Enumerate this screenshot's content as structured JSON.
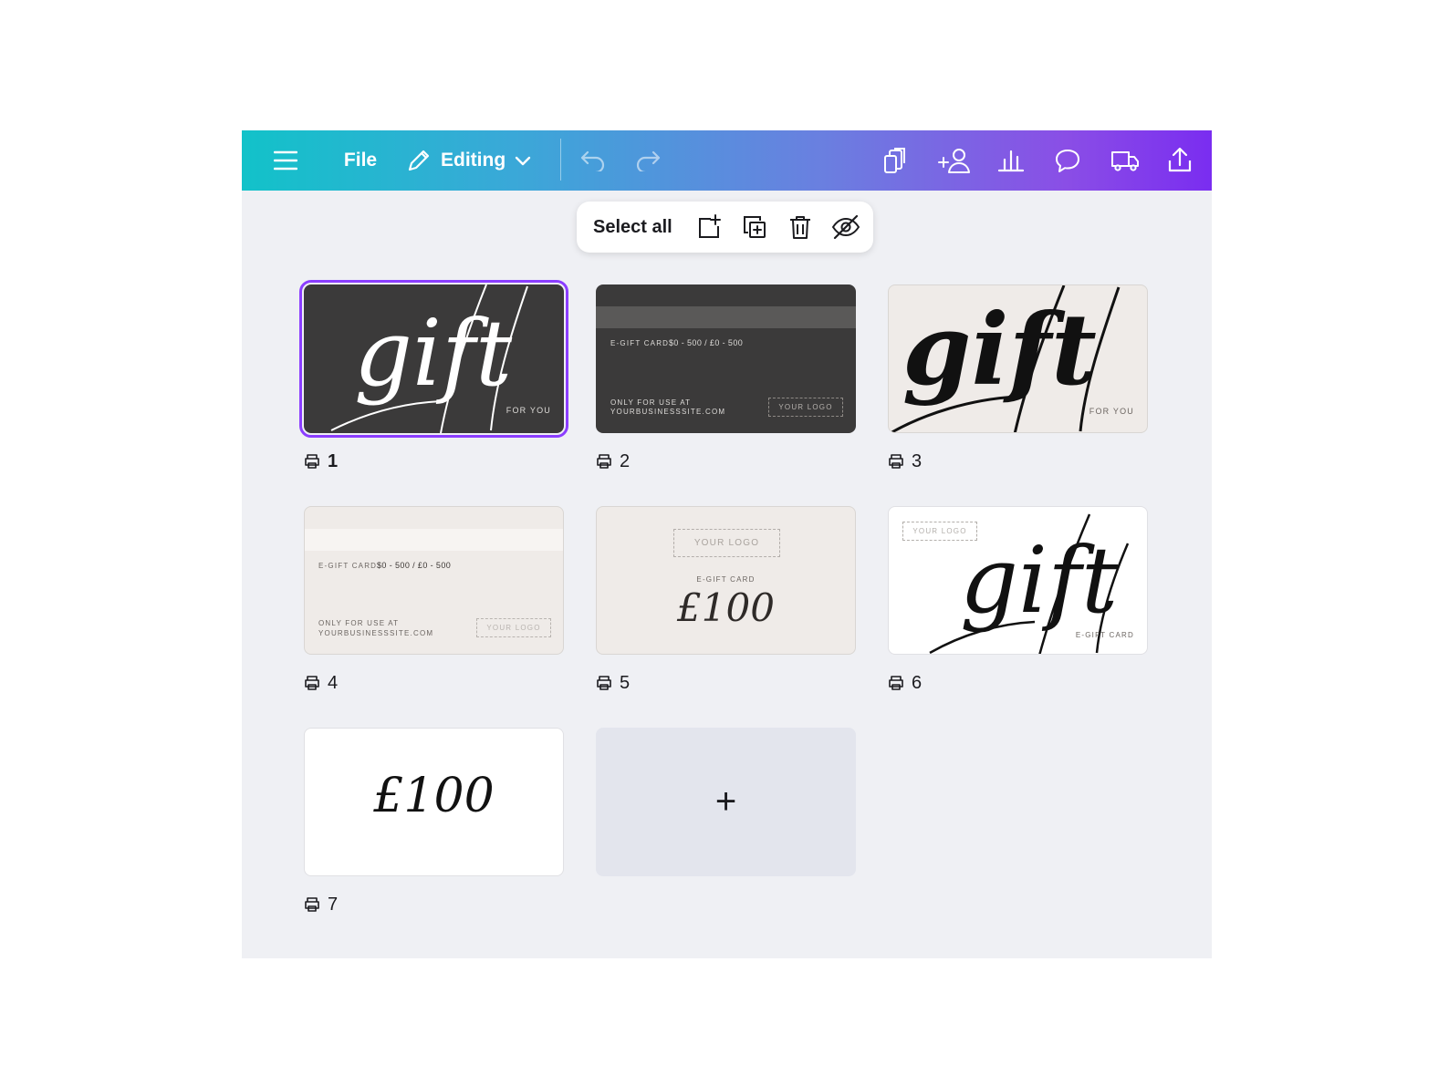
{
  "toolbar": {
    "file_label": "File",
    "editing_label": "Editing",
    "icons": [
      "menu-icon",
      "pencil-icon",
      "chevron-down-icon",
      "undo-icon",
      "redo-icon",
      "resize-pages-icon",
      "share-people-icon",
      "insights-chart-icon",
      "comment-icon",
      "print-delivery-truck-icon",
      "share-upload-icon"
    ]
  },
  "selection_bar": {
    "select_all_label": "Select all",
    "icons": [
      "add-page-icon",
      "duplicate-page-icon",
      "trash-icon",
      "hide-icon"
    ]
  },
  "pages": [
    {
      "number": "1",
      "selected": true,
      "tagline": "FOR YOU",
      "word": "gift"
    },
    {
      "number": "2",
      "egift_label": "E-GIFT CARD",
      "amount": "$0 - 500 / £0 - 500",
      "only_use_line1": "ONLY FOR USE AT",
      "only_use_line2": "YOURBUSINESSSITE.COM",
      "logo": "YOUR LOGO"
    },
    {
      "number": "3",
      "tagline": "FOR YOU",
      "word": "gift"
    },
    {
      "number": "4",
      "egift_label": "E-GIFT CARD",
      "amount": "$0 - 500 / £0 - 500",
      "only_use_line1": "ONLY FOR USE AT",
      "only_use_line2": "YOURBUSINESSSITE.COM",
      "logo": "YOUR LOGO"
    },
    {
      "number": "5",
      "logo": "YOUR LOGO",
      "egift_label": "E-GIFT CARD",
      "price": "£100"
    },
    {
      "number": "6",
      "logo": "YOUR LOGO",
      "egift_label": "E-GIFT CARD",
      "word": "gift"
    },
    {
      "number": "7",
      "price": "£100"
    }
  ],
  "add_page_symbol": "+",
  "colors": {
    "selection": "#8b3dff",
    "canvas": "#eff0f4",
    "dark_card": "#3b3a3a",
    "cream_card": "#efebe8"
  }
}
